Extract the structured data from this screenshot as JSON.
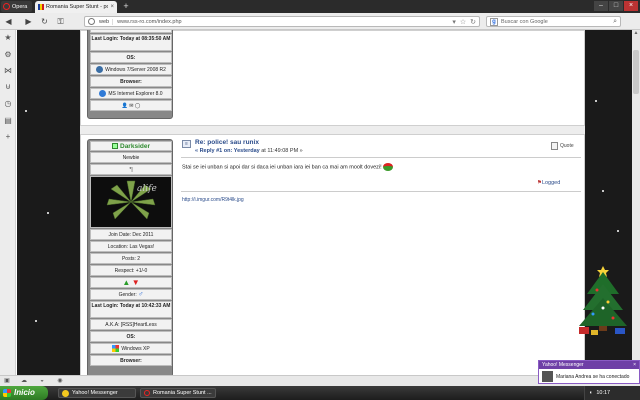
{
  "browser": {
    "opera_label": "Opera",
    "tab_title": "Romania Super Stunt - po...",
    "address_mode": "web",
    "address_url": "www.rss-ro.com/index.php",
    "search_placeholder": "Buscar con Google"
  },
  "post_prev": {
    "last_login_label": "Last Login:",
    "last_login_value": "Today at 08:35:50 AM",
    "os_label": "OS:",
    "os_value": "Windows 7/Server 2008 R2",
    "browser_label": "Browser:",
    "browser_value": "MS Internet Explorer 8.0"
  },
  "post": {
    "author": "Darksider",
    "rank": "Newbie",
    "stars": "*|",
    "join_date": "Join Date: Dec 2011",
    "location": "Location: Las Vegas!",
    "posts": "Posts: 2",
    "respect": "Respect: +1/-0",
    "gender_label": "Gender:",
    "gender_symbol": "♂",
    "last_login_label": "Last Login:",
    "last_login_value": "Today at 10:42:33 AM",
    "aka": "A.K.A: [RSS]HeartLess",
    "os_label": "OS:",
    "os_value": "Windows XP",
    "browser_label": "Browser:",
    "subject": "Re: police! sau runix",
    "reply_prefix": "« Reply #1 on: Yesterday",
    "reply_time": "at 11:49:08 PM »",
    "quote_label": "Quote",
    "body": "Stai se iei unban si apoi dar si daca iei unban iara iei ban ca mai am moolt dovezi!",
    "logged_label": "Logged",
    "signature_link": "http://i.imgur.com/R9t4lk.jpg"
  },
  "taskbar": {
    "start_label": "Inicio",
    "items": [
      {
        "label": "Yahoo! Messenger"
      },
      {
        "label": "Romania Super Stunt ..."
      }
    ],
    "clock": "10:17"
  },
  "popup": {
    "title": "Yahoo! Messenger",
    "message": "Mariana Andrea se ha conectado"
  },
  "colors": {
    "link_blue": "#2a4b8a",
    "start_green": "#3c9330",
    "popup_purple": "#6e3fa6"
  }
}
